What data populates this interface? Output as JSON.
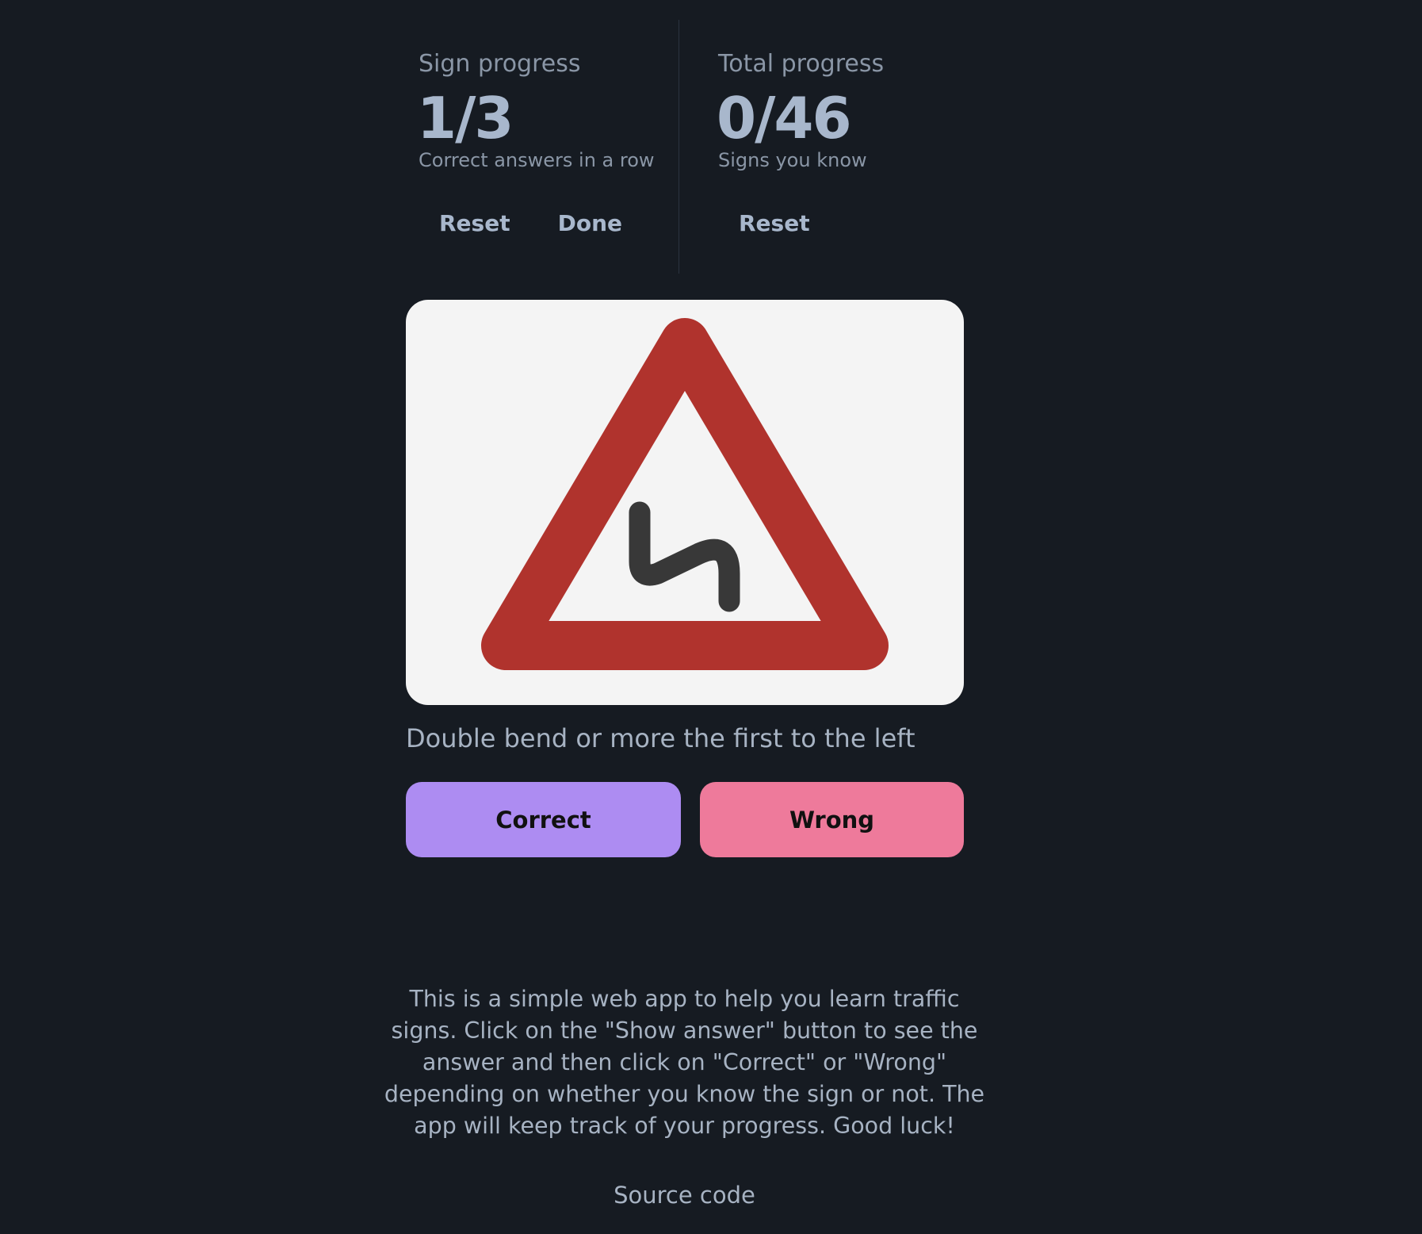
{
  "sign_progress": {
    "title": "Sign progress",
    "value": "1/3",
    "description": "Correct answers in a row",
    "reset_label": "Reset",
    "done_label": "Done"
  },
  "total_progress": {
    "title": "Total progress",
    "value": "0/46",
    "description": "Signs you know",
    "reset_label": "Reset"
  },
  "sign": {
    "icon": "double-bend-warning-sign",
    "name": "Double bend or more the first to the left",
    "colors": {
      "border": "#b0332d",
      "background": "#f4f4f4",
      "symbol": "#383838"
    }
  },
  "answers": {
    "correct_label": "Correct",
    "wrong_label": "Wrong",
    "correct_color": "#ad8cf2",
    "wrong_color": "#ee7a9b"
  },
  "footer": {
    "about": "This is a simple web app to help you learn traffic signs. Click on the \"Show answer\" button to see the answer and then click on \"Correct\" or \"Wrong\" depending on whether you know the sign or not. The app will keep track of your progress. Good luck!",
    "source_label": "Source code"
  },
  "theme": {
    "background": "#161b22",
    "text": "#a7b3c3"
  }
}
